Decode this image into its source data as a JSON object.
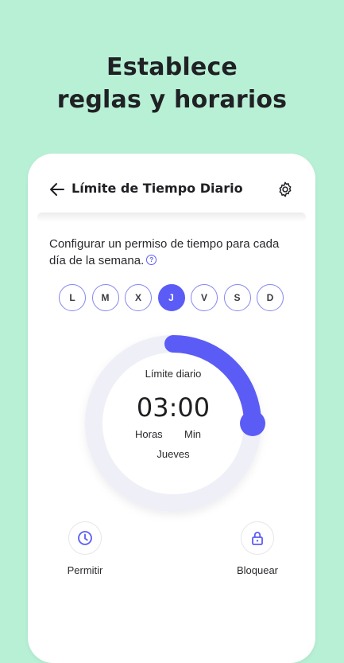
{
  "headline": {
    "line1": "Establece",
    "line2": "reglas y horarios"
  },
  "appbar": {
    "title": "Límite de Tiempo Diario"
  },
  "description": "Configurar un permiso de tiempo para cada día de la semana.",
  "days": [
    "L",
    "M",
    "X",
    "J",
    "V",
    "S",
    "D"
  ],
  "selected_day": "J",
  "dial": {
    "label": "Límite diario",
    "time": "03:00",
    "hours_label": "Horas",
    "minutes_label": "Min",
    "day_name": "Jueves",
    "progress_fraction": 0.25
  },
  "actions": {
    "allow": "Permitir",
    "block": "Bloquear"
  },
  "colors": {
    "background": "#b8f0d6",
    "accent": "#5b5cf6",
    "track": "#efeff8"
  },
  "icons": [
    "back-arrow-icon",
    "gear-icon",
    "help-icon",
    "clock-icon",
    "lock-icon"
  ]
}
